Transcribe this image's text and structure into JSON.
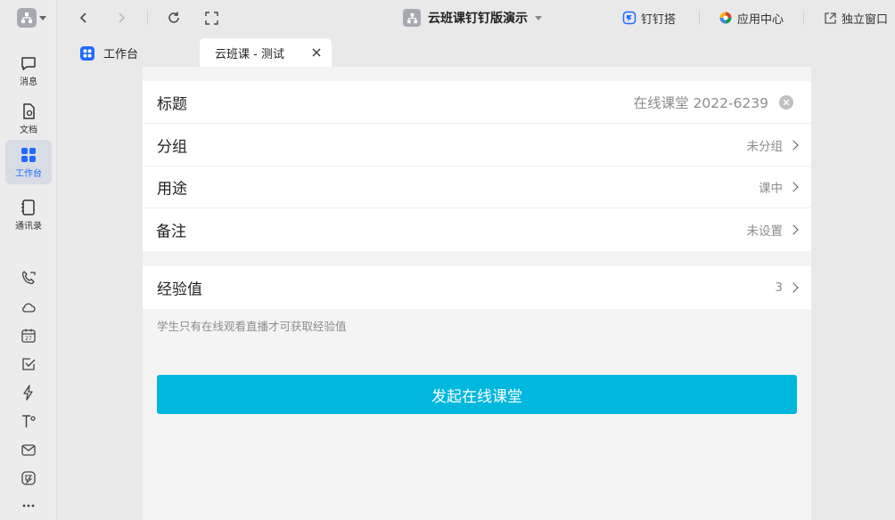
{
  "sidebar": {
    "items": [
      {
        "label": "消息",
        "icon": "message-icon"
      },
      {
        "label": "文档",
        "icon": "document-icon"
      },
      {
        "label": "工作台",
        "icon": "workbench-icon",
        "active": true
      },
      {
        "label": "通讯录",
        "icon": "contacts-icon"
      }
    ],
    "tools": [
      "phone-icon",
      "cloud-icon",
      "calendar-icon",
      "todo-icon",
      "flash-icon",
      "typeface-icon",
      "mail-icon",
      "dingtalk-icon",
      "more-icon"
    ],
    "calendar_day": "27"
  },
  "topbar": {
    "title": "云班课钉钉版演示",
    "links": [
      {
        "label": "钉钉搭",
        "icon": "dingda-icon"
      },
      {
        "label": "应用中心",
        "icon": "app-center-icon"
      },
      {
        "label": "独立窗口",
        "icon": "detach-window-icon"
      }
    ]
  },
  "tabs": [
    {
      "label": "工作台",
      "active": false
    },
    {
      "label": "云班课 - 测试",
      "active": true
    }
  ],
  "form": {
    "title": {
      "label": "标题",
      "value": "在线课堂 2022-6239"
    },
    "group": {
      "label": "分组",
      "value": "未分组"
    },
    "purpose": {
      "label": "用途",
      "value": "课中"
    },
    "note": {
      "label": "备注",
      "value": "未设置"
    },
    "exp": {
      "label": "经验值",
      "value": "3"
    },
    "hint": "学生只有在线观看直播才可获取经验值",
    "submit_label": "发起在线课堂"
  },
  "colors": {
    "accent": "#1f6bff",
    "primary_button": "#00b7dd"
  }
}
